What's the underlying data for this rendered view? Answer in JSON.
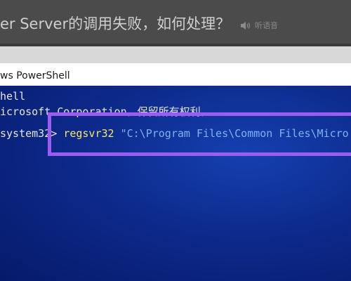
{
  "browser": {
    "article_title": "er Server的调用失败，如何处理？",
    "listen_label": "听语音",
    "icons": {
      "listen": "speaker-icon"
    }
  },
  "window": {
    "title": "ws PowerShell"
  },
  "console": {
    "line1": "hell",
    "line2": "icrosoft Corporation。保留所有权利。",
    "prompt": "system32> ",
    "command": "regsvr32",
    "argument": " \"C:\\Program Files\\Common Files\\Micro"
  },
  "colors": {
    "console_bg": "#0d2a8c",
    "command": "#f7e76a",
    "argument": "#7fb3f0",
    "highlight_border": "#9b5cf0"
  }
}
